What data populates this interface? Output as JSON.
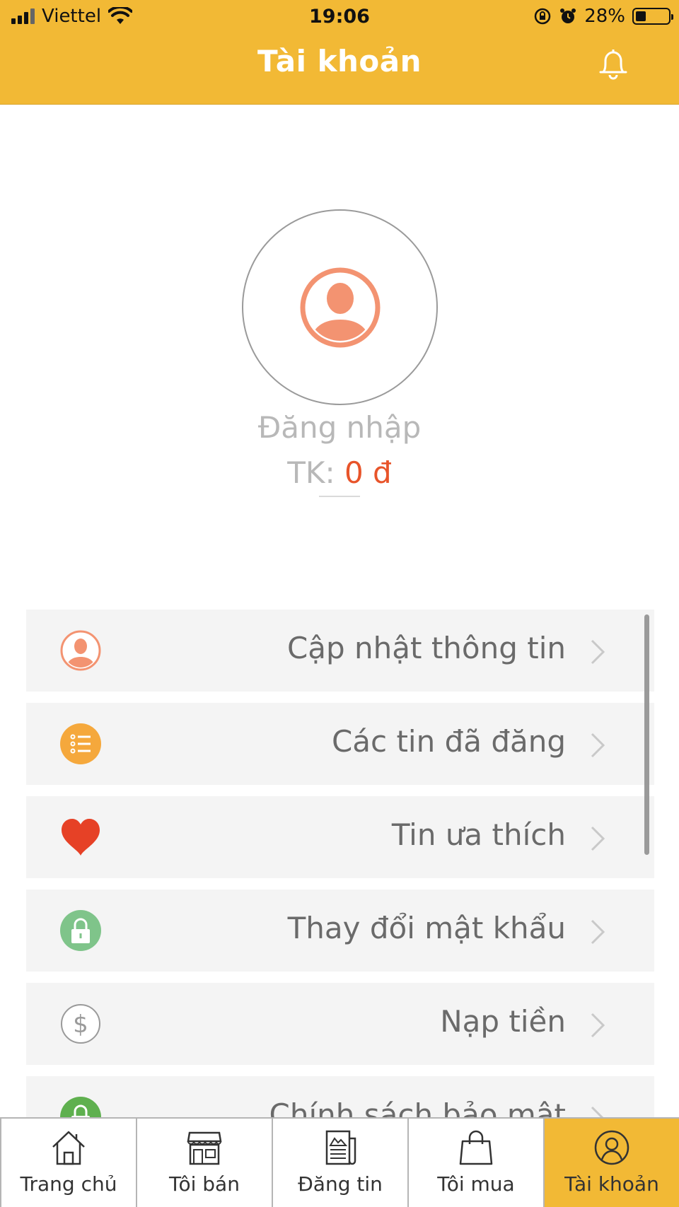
{
  "status_bar": {
    "carrier": "Viettel",
    "time": "19:06",
    "battery": "28%",
    "battery_level": 0.28
  },
  "header": {
    "title": "Tài khoản"
  },
  "profile": {
    "login_label": "Đăng nhập",
    "balance_prefix": "TK:",
    "balance_amount": "0 đ"
  },
  "menu": {
    "items": [
      {
        "label": "Cập nhật thông tin",
        "icon": "user-icon",
        "color": "#f39371"
      },
      {
        "label": "Các tin đã đăng",
        "icon": "list-icon",
        "color": "#f5a83c"
      },
      {
        "label": "Tin ưa thích",
        "icon": "heart-icon",
        "color": "#e64126"
      },
      {
        "label": "Thay đổi mật khẩu",
        "icon": "lock-icon",
        "color": "#7fc48a"
      },
      {
        "label": "Nạp tiền",
        "icon": "dollar-icon",
        "color": "#9a9a9a"
      },
      {
        "label": "Chính sách bảo mật",
        "icon": "lock-icon",
        "color": "#5fb04f"
      }
    ]
  },
  "tabbar": {
    "tabs": [
      {
        "label": "Trang chủ",
        "icon": "home-icon"
      },
      {
        "label": "Tôi bán",
        "icon": "store-icon"
      },
      {
        "label": "Đăng tin",
        "icon": "newspaper-icon"
      },
      {
        "label": "Tôi mua",
        "icon": "shopping-bag-icon"
      },
      {
        "label": "Tài khoản",
        "icon": "account-icon",
        "active": true
      }
    ]
  },
  "colors": {
    "primary": "#f2b935",
    "accent": "#e8542a",
    "avatar": "#f39371"
  }
}
